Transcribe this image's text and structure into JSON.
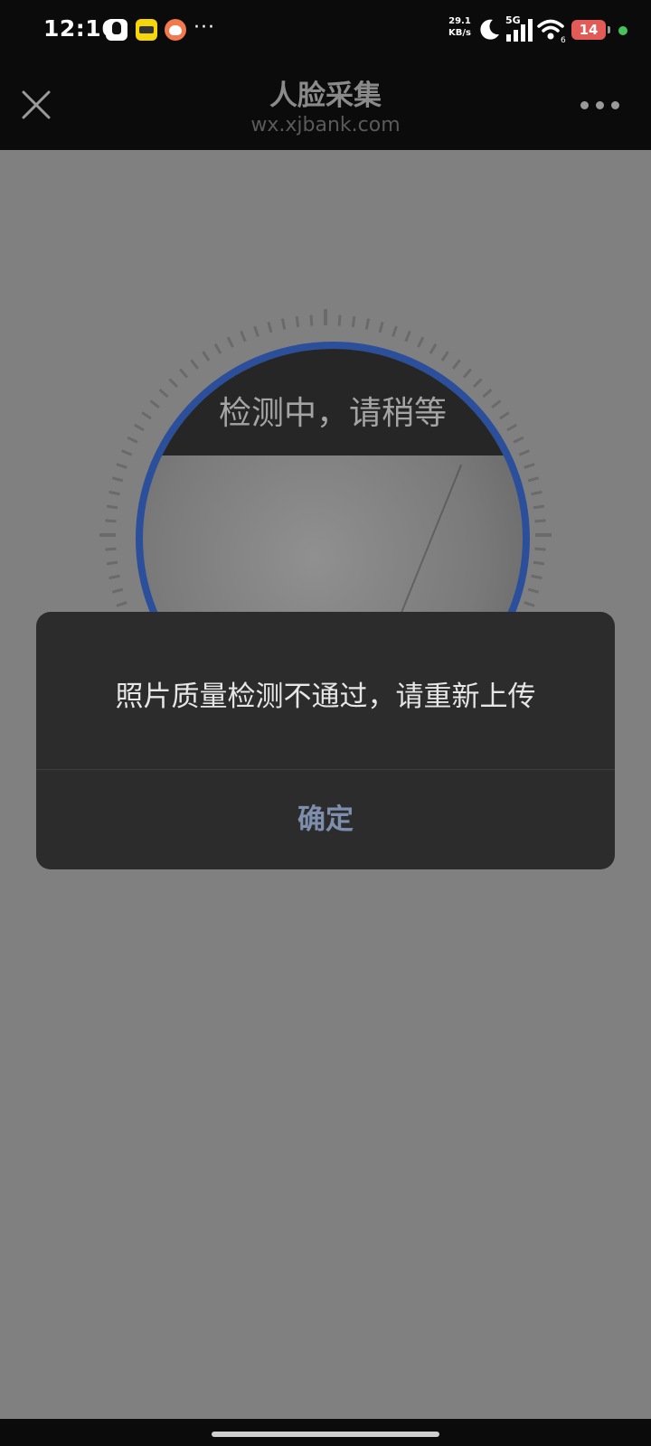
{
  "status_bar": {
    "time": "12:16",
    "more": "···",
    "net_speed_value": "29.1",
    "net_speed_unit": "KB/s",
    "network_type": "5G",
    "wifi_level": "6",
    "battery": "14"
  },
  "nav": {
    "title": "人脸采集",
    "subtitle": "wx.xjbank.com"
  },
  "capture": {
    "status_text": "检测中，请稍等"
  },
  "dialog": {
    "message": "照片质量检测不通过，请重新上传",
    "ok_label": "确定"
  },
  "colors": {
    "accent_ring": "#2c4f9b",
    "dialog_button": "#7d8fad",
    "battery_low": "#e35b56"
  }
}
